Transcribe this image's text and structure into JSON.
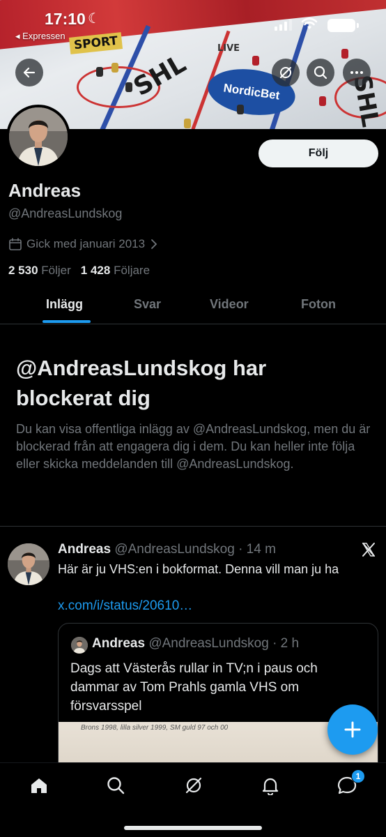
{
  "status_bar": {
    "time": "17:10",
    "back_to_app": "◂ Expressen"
  },
  "banner": {
    "sponsor": "NordicBet",
    "league": "SHL",
    "sport_text": "SPORT",
    "live_text": "LIVE"
  },
  "profile": {
    "name": "Andreas",
    "handle": "@AndreasLundskog",
    "joined": "Gick med januari 2013",
    "following_count": "2 530",
    "following_label": "Följer",
    "followers_count": "1 428",
    "followers_label": "Följare",
    "follow_button": "Följ"
  },
  "tabs": [
    {
      "label": "Inlägg",
      "active": true
    },
    {
      "label": "Svar",
      "active": false
    },
    {
      "label": "Videor",
      "active": false
    },
    {
      "label": "Foton",
      "active": false
    }
  ],
  "blocked": {
    "title": "@AndreasLundskog har blockerat dig",
    "text": "Du kan visa offentliga inlägg av @AndreasLundskog, men du är blockerad från att engagera dig i dem. Du kan heller inte följa eller skicka meddelanden till @AndreasLundskog."
  },
  "post": {
    "author": "Andreas",
    "handle": "@AndreasLundskog",
    "time": "· 14 m",
    "text": "Här är ju VHS:en i bokformat. Denna vill man ju ha",
    "link": "x.com/i/status/20610…",
    "quote": {
      "author": "Andreas",
      "handle": "@AndreasLundskog",
      "time": "· 2 h",
      "text": "Dags att Västerås rullar in TV;n i paus och dammar av Tom Prahls gamla VHS om försvarsspel",
      "image_caption": "Brons 1998, lilla silver 1999, SM guld 97 och 00"
    }
  },
  "bottom_nav": {
    "items": [
      "home-icon",
      "search-icon",
      "grok-icon",
      "notifications-icon",
      "messages-icon"
    ],
    "messages_badge": "1"
  },
  "colors": {
    "accent": "#1d9bf0",
    "text": "#e7e9ea",
    "muted": "#71767b",
    "border": "#2f3336",
    "background": "#000000"
  }
}
